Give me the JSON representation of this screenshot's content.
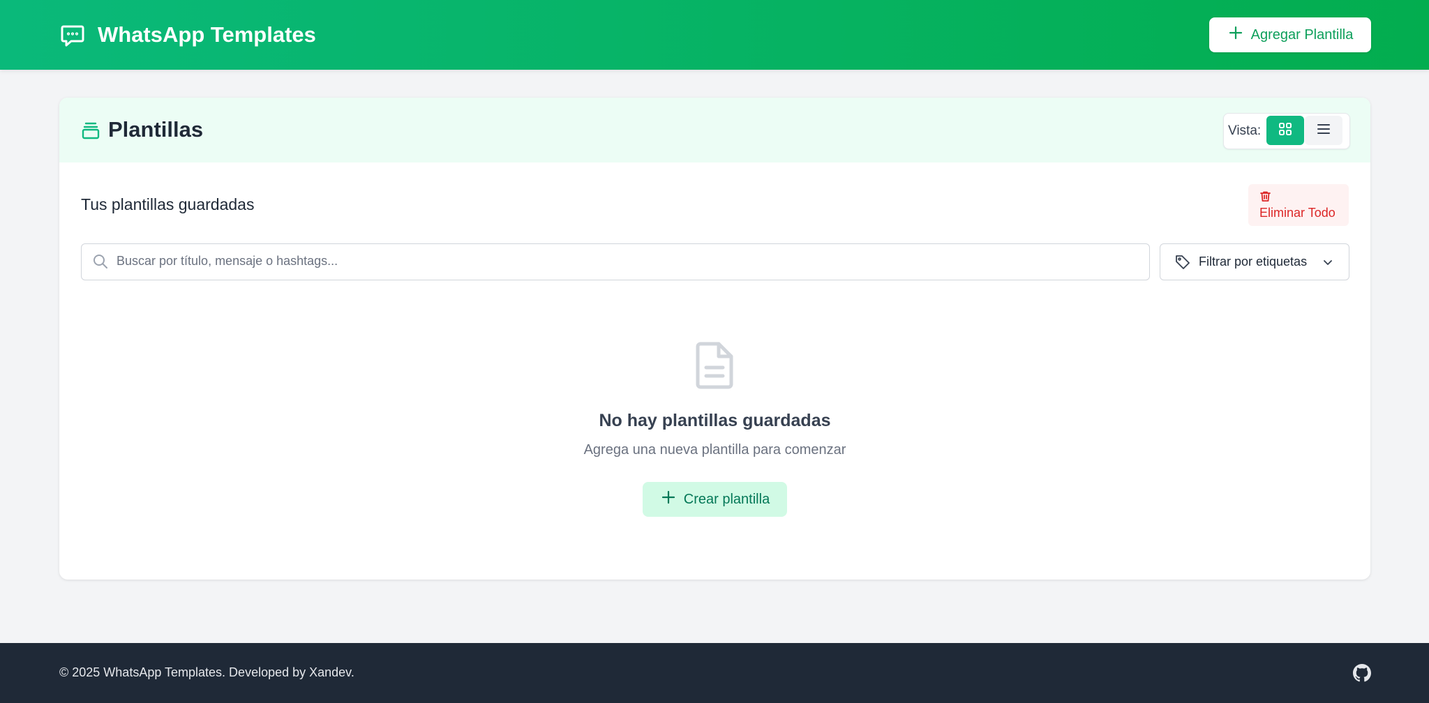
{
  "header": {
    "brand_icon": "chat-bubble-icon",
    "title": "WhatsApp Templates",
    "add_button_label": "Agregar Plantilla",
    "add_button_icon": "plus-icon",
    "colors": {
      "gradient_start": "#0ab97a",
      "gradient_end": "#03ad4f"
    }
  },
  "card": {
    "title": "Plantillas",
    "title_icon": "stack-icon",
    "view_label": "Vista:",
    "views": [
      {
        "name": "grid",
        "icon": "grid-icon",
        "active": true
      },
      {
        "name": "list",
        "icon": "list-icon",
        "active": false
      }
    ],
    "subtitle": "Tus plantillas guardadas",
    "delete_all_label": "Eliminar Todo",
    "delete_all_icon": "trash-icon",
    "search": {
      "placeholder": "Buscar por título, mensaje o hashtags...",
      "value": ""
    },
    "tag_filter": {
      "label": "Filtrar por etiquetas",
      "icon": "tag-icon"
    }
  },
  "empty_state": {
    "icon": "document-icon",
    "title": "No hay plantillas guardadas",
    "description": "Agrega una nueva plantilla para comenzar",
    "button_label": "Crear plantilla"
  },
  "footer": {
    "text": "© 2025 WhatsApp Templates. Developed by Xandev.",
    "link_icon": "github-icon"
  },
  "colors": {
    "accent": "#10b981",
    "danger": "#dc2626",
    "footer_bg": "#1f2937"
  }
}
